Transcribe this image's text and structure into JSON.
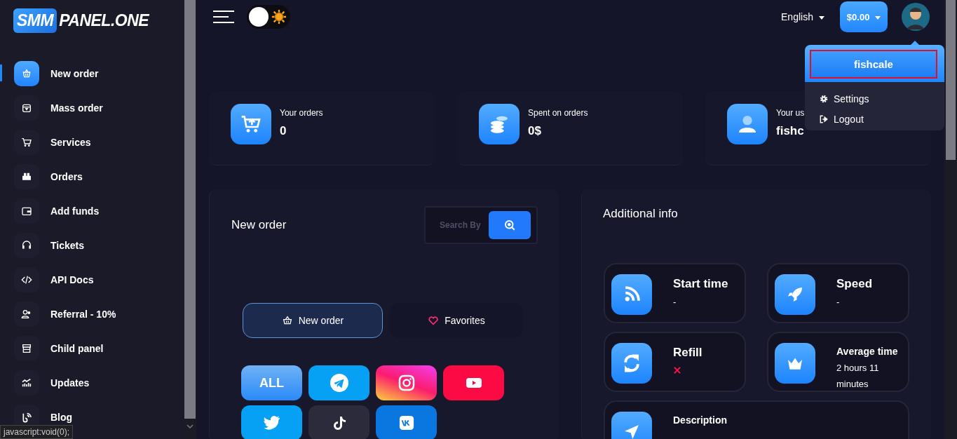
{
  "brand": {
    "highlight": "SMM",
    "rest": "PANEL.ONE"
  },
  "theme_toggle": {
    "on": false
  },
  "sidebar": {
    "items": [
      {
        "label": "New order",
        "selected": true
      },
      {
        "label": "Mass order",
        "selected": false
      },
      {
        "label": "Services",
        "selected": false
      },
      {
        "label": "Orders",
        "selected": false
      },
      {
        "label": "Add funds",
        "selected": false
      },
      {
        "label": "Tickets",
        "selected": false
      },
      {
        "label": "API Docs",
        "selected": false
      },
      {
        "label": "Referral - 10%",
        "selected": false
      },
      {
        "label": "Child panel",
        "selected": false
      },
      {
        "label": "Updates",
        "selected": false
      },
      {
        "label": "Blog",
        "selected": false
      }
    ]
  },
  "topbar": {
    "language": "English",
    "balance": "$0.00"
  },
  "user_menu": {
    "username": "fishcale",
    "items": [
      {
        "label": "Settings"
      },
      {
        "label": "Logout"
      }
    ]
  },
  "stats": [
    {
      "label": "Your orders",
      "value": "0"
    },
    {
      "label": "Spent on orders",
      "value": "0$"
    },
    {
      "label": "Your us",
      "value": "fishc"
    }
  ],
  "order_panel": {
    "title": "New order",
    "search": {
      "placeholder": "Search By"
    },
    "tabs": [
      {
        "label": "New order",
        "selected": true
      },
      {
        "label": "Favorites",
        "selected": false
      }
    ],
    "categories": [
      {
        "kind": "all",
        "label": "ALL"
      },
      {
        "kind": "telegram"
      },
      {
        "kind": "instagram"
      },
      {
        "kind": "youtube"
      },
      {
        "kind": "twitter"
      },
      {
        "kind": "tiktok"
      },
      {
        "kind": "vk"
      }
    ]
  },
  "info_panel": {
    "title": "Additional info",
    "cards": [
      {
        "kind": "text",
        "title": "Start time",
        "value": "-"
      },
      {
        "kind": "text",
        "title": "Speed",
        "value": "-"
      },
      {
        "kind": "flag",
        "title": "Refill",
        "available": false
      },
      {
        "kind": "text",
        "title": "Average time",
        "value": "2 hours 11 minutes"
      },
      {
        "kind": "text",
        "title": "Description"
      }
    ]
  },
  "status_bar": "javascript:void(0);"
}
